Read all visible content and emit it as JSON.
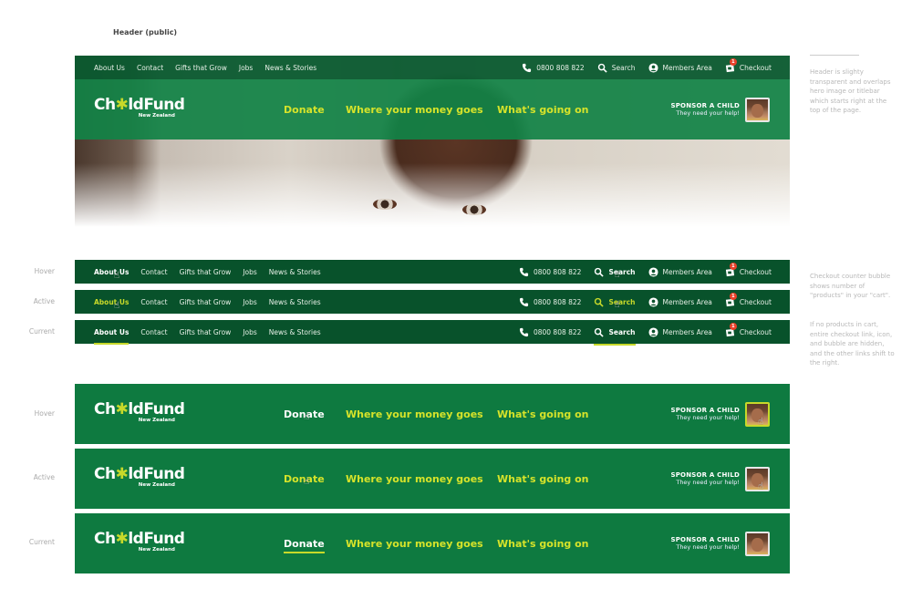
{
  "section_title": "Header (public)",
  "util_nav": {
    "links": [
      "About Us",
      "Contact",
      "Gifts that Grow",
      "Jobs",
      "News & Stories"
    ],
    "phone": "0800 808 822",
    "search": "Search",
    "members": "Members Area",
    "checkout": "Checkout",
    "cart_count": "1"
  },
  "main_nav": {
    "logo_main": "Ch",
    "logo_star": "✱",
    "logo_end": "ldFund",
    "logo_sub": "New Zealand",
    "links": [
      "Donate",
      "Where your money goes",
      "What's going on"
    ],
    "sponsor_title": "SPONSOR A CHILD",
    "sponsor_sub": "They need your help!"
  },
  "states": {
    "hover": "Hover",
    "active": "Active",
    "current": "Current"
  },
  "notes": {
    "header": "Header is slighty transparent and overlaps hero image or titlebar which starts right at the top of the page.",
    "checkout_1": "Checkout counter bubble shows number of \"products\" in your \"cart\".",
    "checkout_2": "If no products in cart, entire checkout link, icon, and bubble are hidden, and the other links shift to the right."
  },
  "colors": {
    "util_green": "#0a5a2f",
    "main_green": "#0e7a40",
    "accent_yellow": "#d6e32a",
    "badge_red": "#e8412a"
  }
}
